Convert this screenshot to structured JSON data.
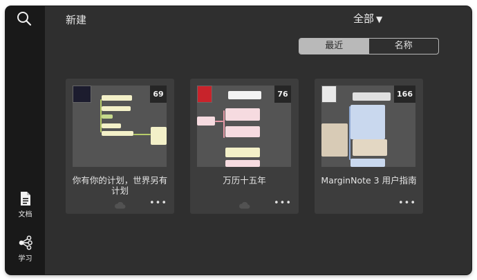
{
  "sidebar": {
    "search_icon": "search-icon",
    "items": [
      {
        "label": "文档",
        "icon": "document-icon"
      },
      {
        "label": "学习",
        "icon": "share-graph-icon"
      }
    ]
  },
  "header": {
    "new_label": "新建",
    "filter_label": "全部",
    "filter_caret": "▼"
  },
  "sort": {
    "options": [
      "最近",
      "名称"
    ],
    "selected": "最近"
  },
  "notebooks": [
    {
      "title": "你有你的计划，世界另有计划",
      "count": "69"
    },
    {
      "title": "万历十五年",
      "count": "76"
    },
    {
      "title": "MarginNote 3 用户指南",
      "count": "166"
    }
  ],
  "more_glyph": "•••",
  "colors": {
    "sidebar_bg": "#191919",
    "main_bg": "#2f2f2f",
    "card_bg": "#3d3d3d",
    "segment_active": "#b9b9b9"
  }
}
